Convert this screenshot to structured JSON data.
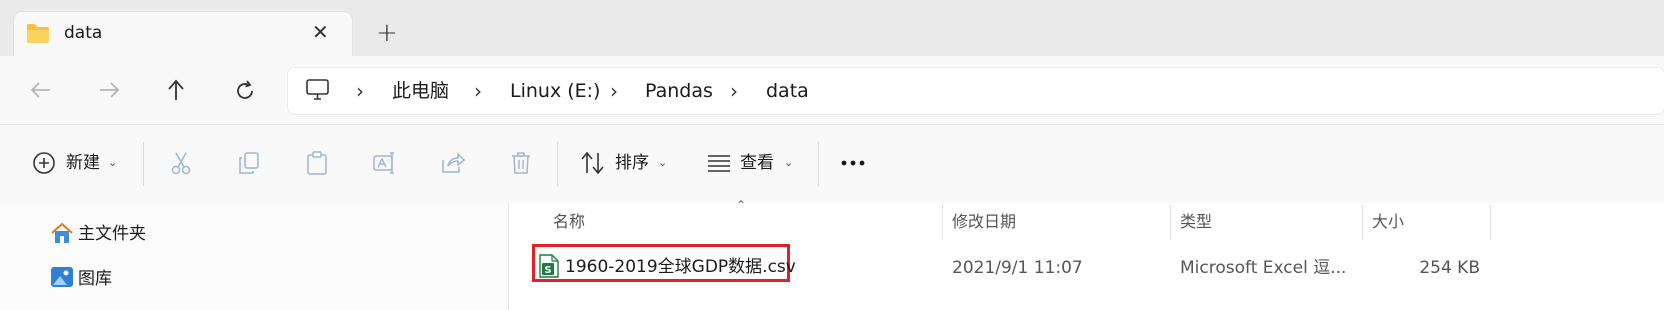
{
  "tab": {
    "title": "data",
    "close_icon": "close-icon",
    "new_tab_icon": "plus-icon"
  },
  "nav": {
    "back_icon": "arrow-left-icon",
    "forward_icon": "arrow-right-icon",
    "up_icon": "arrow-up-icon",
    "refresh_icon": "refresh-icon"
  },
  "breadcrumb": [
    "此电脑",
    "Linux (E:)",
    "Pandas",
    "data"
  ],
  "toolbar": {
    "new_label": "新建",
    "sort_label": "排序",
    "view_label": "查看",
    "more_icon": "more-icon"
  },
  "sidebar": {
    "items": [
      {
        "label": "主文件夹"
      },
      {
        "label": "图库"
      }
    ]
  },
  "columns": {
    "name": "名称",
    "modified": "修改日期",
    "type": "类型",
    "size": "大小"
  },
  "files": [
    {
      "name": "1960-2019全球GDP数据.csv",
      "modified": "2021/9/1 11:07",
      "type": "Microsoft Excel 逗...",
      "size": "254 KB"
    }
  ],
  "colors": {
    "highlight": "#e0202a",
    "folder": "#f6c244",
    "excel": "#1f7a45"
  }
}
